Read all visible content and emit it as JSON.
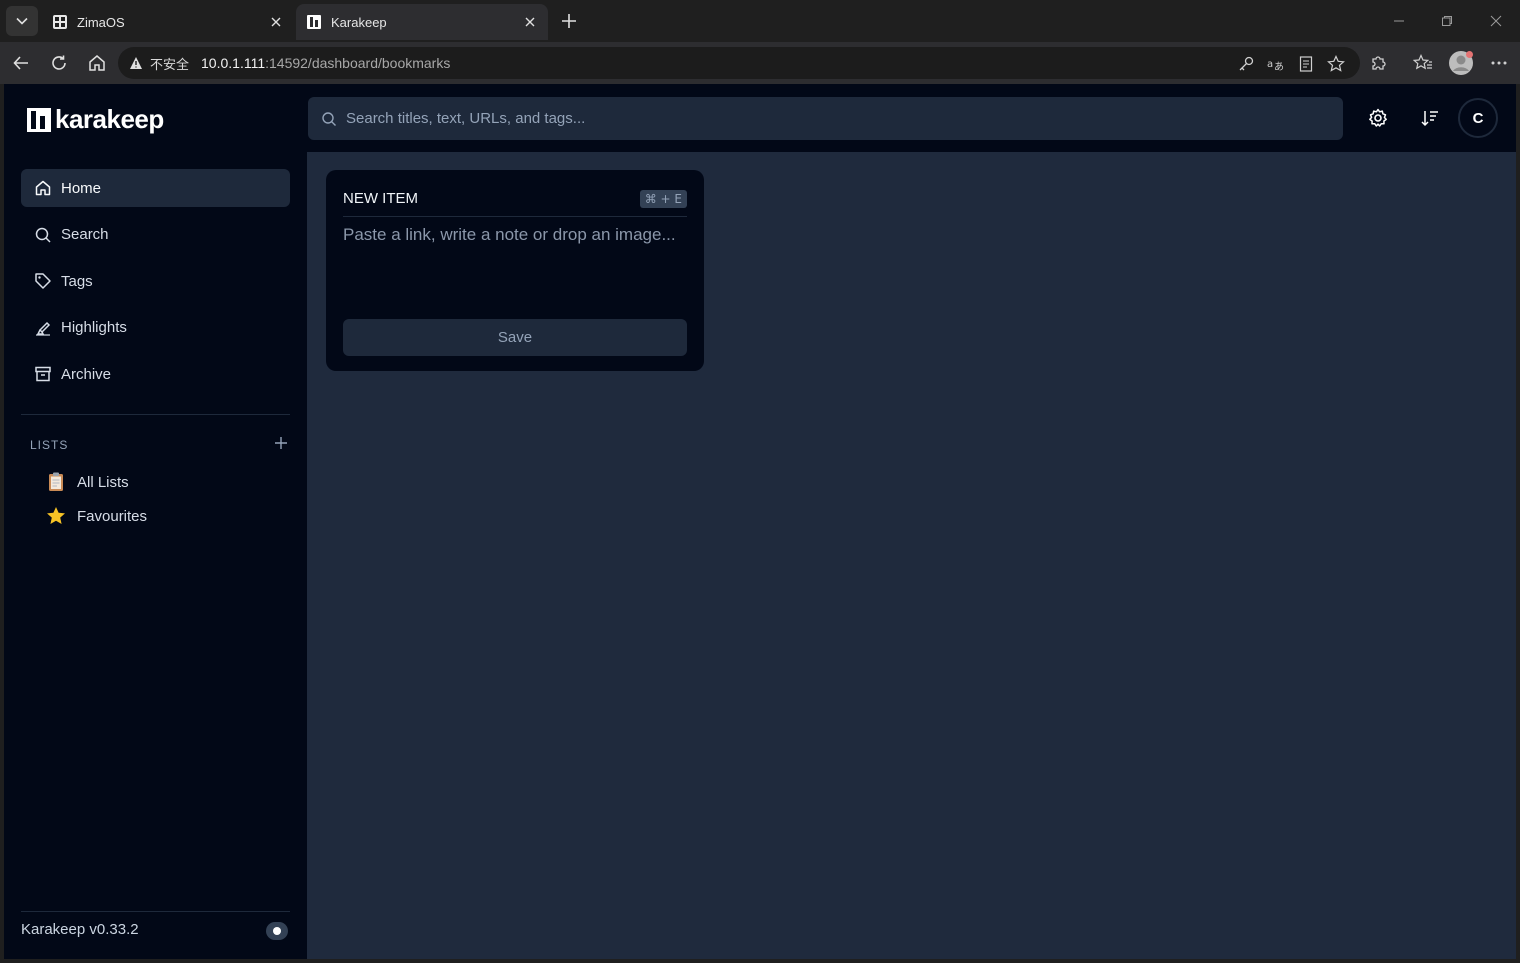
{
  "browser": {
    "tabs": [
      {
        "title": "ZimaOS",
        "favicon": "zimaos-icon",
        "active": false
      },
      {
        "title": "Karakeep",
        "favicon": "karakeep-icon",
        "active": true
      }
    ],
    "address": {
      "security_label": "不安全",
      "host": "10.0.1.111",
      "path": ":14592/dashboard/bookmarks"
    }
  },
  "app": {
    "brand": "karakeep",
    "search_placeholder": "Search titles, text, URLs, and tags...",
    "avatar_initial": "C",
    "nav": [
      {
        "label": "Home",
        "icon": "home-icon",
        "active": true
      },
      {
        "label": "Search",
        "icon": "search-icon",
        "active": false
      },
      {
        "label": "Tags",
        "icon": "tag-icon",
        "active": false
      },
      {
        "label": "Highlights",
        "icon": "highlighter-icon",
        "active": false
      },
      {
        "label": "Archive",
        "icon": "archive-icon",
        "active": false
      }
    ],
    "lists_heading": "LISTS",
    "lists": [
      {
        "label": "All Lists",
        "emoji": "📋"
      },
      {
        "label": "Favourites",
        "emoji": "⭐"
      }
    ],
    "version": "Karakeep v0.33.2",
    "new_item": {
      "title": "NEW ITEM",
      "shortcut": "⌘ + E",
      "placeholder": "Paste a link, write a note or drop an image...",
      "save_label": "Save"
    }
  },
  "colors": {
    "sidebar_bg": "#020817",
    "content_bg": "#1f2a3d",
    "active_item_bg": "#1e293b",
    "muted_text": "#94a3b8"
  }
}
